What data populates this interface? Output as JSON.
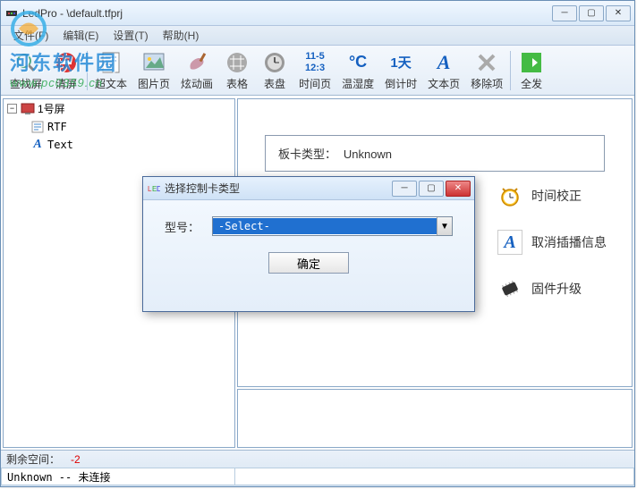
{
  "window": {
    "title": "LedPro - \\default.tfprj"
  },
  "menu": {
    "file": "文件(F)",
    "edit": "编辑(E)",
    "setup": "设置(T)",
    "help": "帮助(H)"
  },
  "watermark": {
    "text": "河东软件园",
    "url": "www.pc0359.cn"
  },
  "toolbar": {
    "find_screen": "查找屏",
    "clear_screen": "清屏",
    "super_text": "超文本",
    "image_page": "图片页",
    "animation": "炫动画",
    "table": "表格",
    "dial": "表盘",
    "time_page": "时间页",
    "time_icon_top": "11-5",
    "time_icon_bot": "12:3",
    "temp_humid": "温湿度",
    "temp_icon": "°C",
    "countdown": "倒计时",
    "countdown_val": "1天",
    "text_page": "文本页",
    "text_glyph": "A",
    "remove": "移除项",
    "send_all": "全发"
  },
  "tree": {
    "root": "1号屏",
    "rtf": "RTF",
    "text": "Text"
  },
  "preview": {
    "card_type_label": "板卡类型：",
    "card_type_value": "Unknown"
  },
  "side_actions": {
    "time_correct": "时间校正",
    "cancel_broadcast": "取消插播信息",
    "firmware_upgrade": "固件升级"
  },
  "modal": {
    "title": "选择控制卡类型",
    "model_label": "型号：",
    "select_value": "-Select-",
    "ok": "确定"
  },
  "status": {
    "remaining_label": "剩余空间：",
    "remaining_value": "-2",
    "connection": "Unknown -- 未连接"
  }
}
